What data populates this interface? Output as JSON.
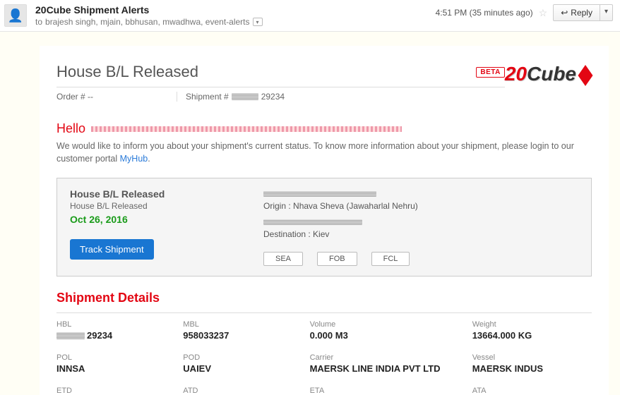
{
  "header": {
    "sender": "20Cube Shipment Alerts",
    "recipients_prefix": "to",
    "recipients": "brajesh singh, mjain, bbhusan, mwadhwa, event-alerts",
    "timestamp": "4:51 PM (35 minutes ago)",
    "reply_label": "Reply"
  },
  "logo": {
    "part1": "20",
    "part2": "Cube"
  },
  "title": "House B/L Released",
  "badge": "BETA",
  "order_label": "Order #",
  "order_value": "--",
  "shipment_label": "Shipment #",
  "shipment_visible_suffix": "29234",
  "hello": "Hello",
  "intro_text_1": "We would like to inform you about your shipment's current status. To know more information about your shipment, please login to our customer portal ",
  "intro_link": "MyHub",
  "intro_text_2": ".",
  "status": {
    "title": "House B/L Released",
    "subtitle": "House B/L Released",
    "date": "Oct 26, 2016",
    "track_label": "Track Shipment",
    "origin_label": "Origin :",
    "origin_value": "Nhava Sheva (Jawaharlal Nehru)",
    "destination_label": "Destination :",
    "destination_value": "Kiev",
    "chips": [
      "SEA",
      "FOB",
      "FCL"
    ]
  },
  "details_title": "Shipment Details",
  "details": {
    "row1": [
      {
        "label": "HBL",
        "value_suffix": "29234",
        "redacted_prefix": true
      },
      {
        "label": "MBL",
        "value": "958033237"
      },
      {
        "label": "Volume",
        "value": "0.000 M3"
      },
      {
        "label": "Weight",
        "value": "13664.000 KG"
      }
    ],
    "row2": [
      {
        "label": "POL",
        "value": "INNSA"
      },
      {
        "label": "POD",
        "value": "UAIEV"
      },
      {
        "label": "Carrier",
        "value": "MAERSK LINE INDIA PVT LTD"
      },
      {
        "label": "Vessel",
        "value": "MAERSK INDUS"
      }
    ],
    "row3": [
      {
        "label": "ETD"
      },
      {
        "label": "ATD"
      },
      {
        "label": "ETA"
      },
      {
        "label": "ATA"
      }
    ]
  }
}
